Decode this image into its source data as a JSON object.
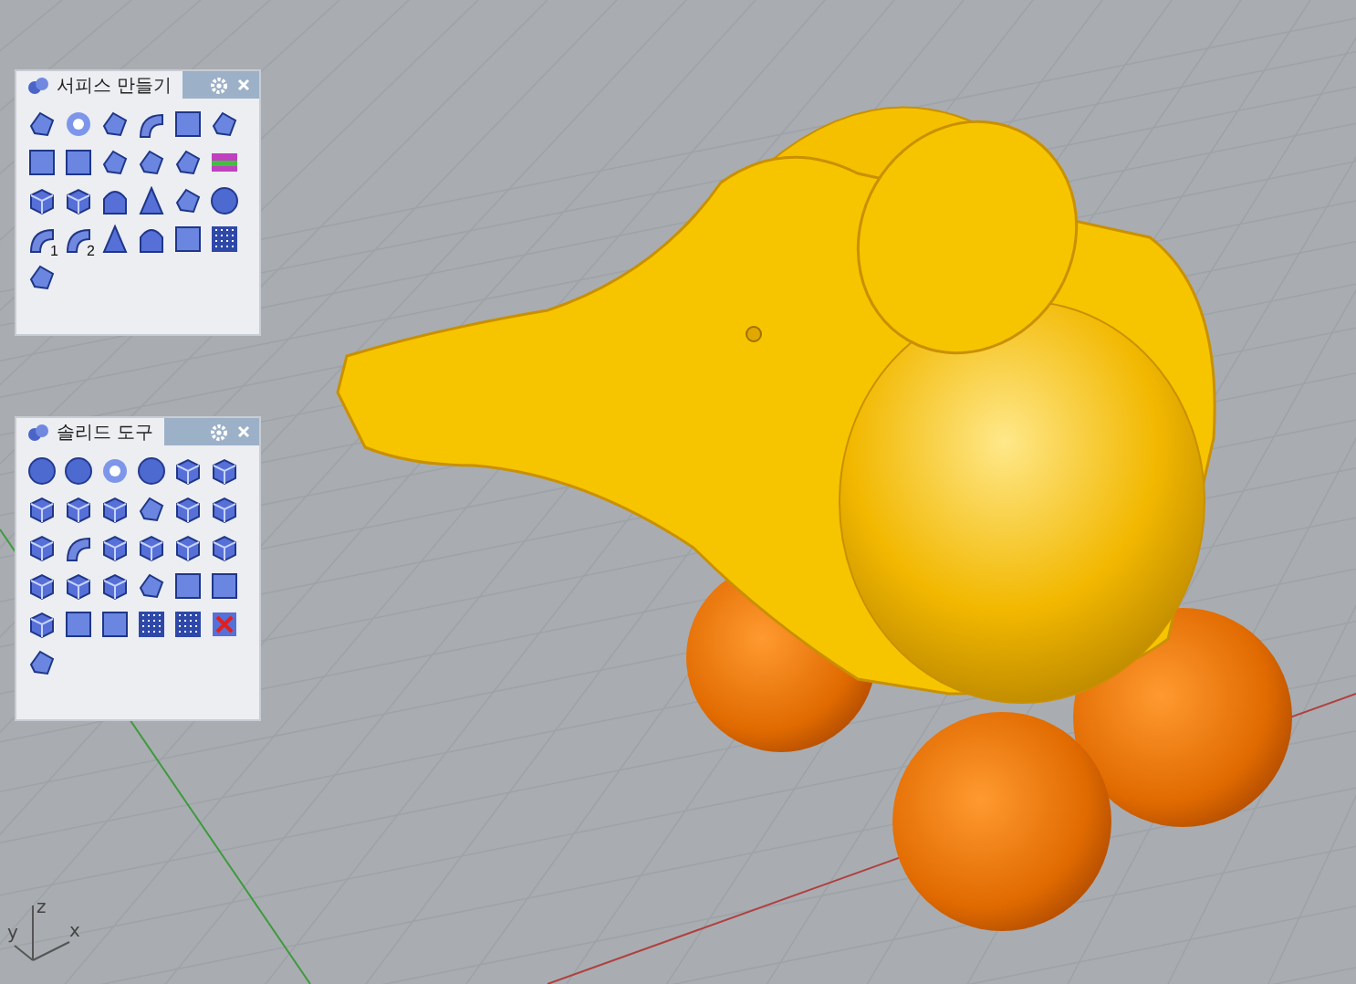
{
  "viewport": {
    "axes": [
      "x",
      "y",
      "z"
    ]
  },
  "toolbars": [
    {
      "title": "서피스 만들기",
      "tools": [
        {
          "kind": "shape"
        },
        {
          "kind": "ring"
        },
        {
          "kind": "shape"
        },
        {
          "kind": "arc"
        },
        {
          "kind": "square"
        },
        {
          "kind": "shape"
        },
        {
          "kind": "square"
        },
        {
          "kind": "square"
        },
        {
          "kind": "shape"
        },
        {
          "kind": "shape"
        },
        {
          "kind": "shape"
        },
        {
          "kind": "rainbow"
        },
        {
          "kind": "cube"
        },
        {
          "kind": "cube"
        },
        {
          "kind": "arch"
        },
        {
          "kind": "cone"
        },
        {
          "kind": "shape"
        },
        {
          "kind": "sphere"
        },
        {
          "kind": "arc",
          "label": "1"
        },
        {
          "kind": "arc",
          "label": "2"
        },
        {
          "kind": "cone"
        },
        {
          "kind": "arch"
        },
        {
          "kind": "square"
        },
        {
          "kind": "grid"
        },
        {
          "kind": "shape"
        }
      ]
    },
    {
      "title": "솔리드 도구",
      "tools": [
        {
          "kind": "sphere"
        },
        {
          "kind": "sphere"
        },
        {
          "kind": "ring"
        },
        {
          "kind": "sphere"
        },
        {
          "kind": "cube"
        },
        {
          "kind": "cube"
        },
        {
          "kind": "cube"
        },
        {
          "kind": "cube"
        },
        {
          "kind": "cube"
        },
        {
          "kind": "shape"
        },
        {
          "kind": "cube"
        },
        {
          "kind": "cube"
        },
        {
          "kind": "cube"
        },
        {
          "kind": "arc"
        },
        {
          "kind": "cube"
        },
        {
          "kind": "cube"
        },
        {
          "kind": "cube"
        },
        {
          "kind": "cube"
        },
        {
          "kind": "cube"
        },
        {
          "kind": "cube"
        },
        {
          "kind": "cube"
        },
        {
          "kind": "shape"
        },
        {
          "kind": "square"
        },
        {
          "kind": "square"
        },
        {
          "kind": "cube"
        },
        {
          "kind": "square"
        },
        {
          "kind": "square"
        },
        {
          "kind": "grid"
        },
        {
          "kind": "grid"
        },
        {
          "kind": "cross"
        },
        {
          "kind": "shape"
        }
      ]
    }
  ]
}
